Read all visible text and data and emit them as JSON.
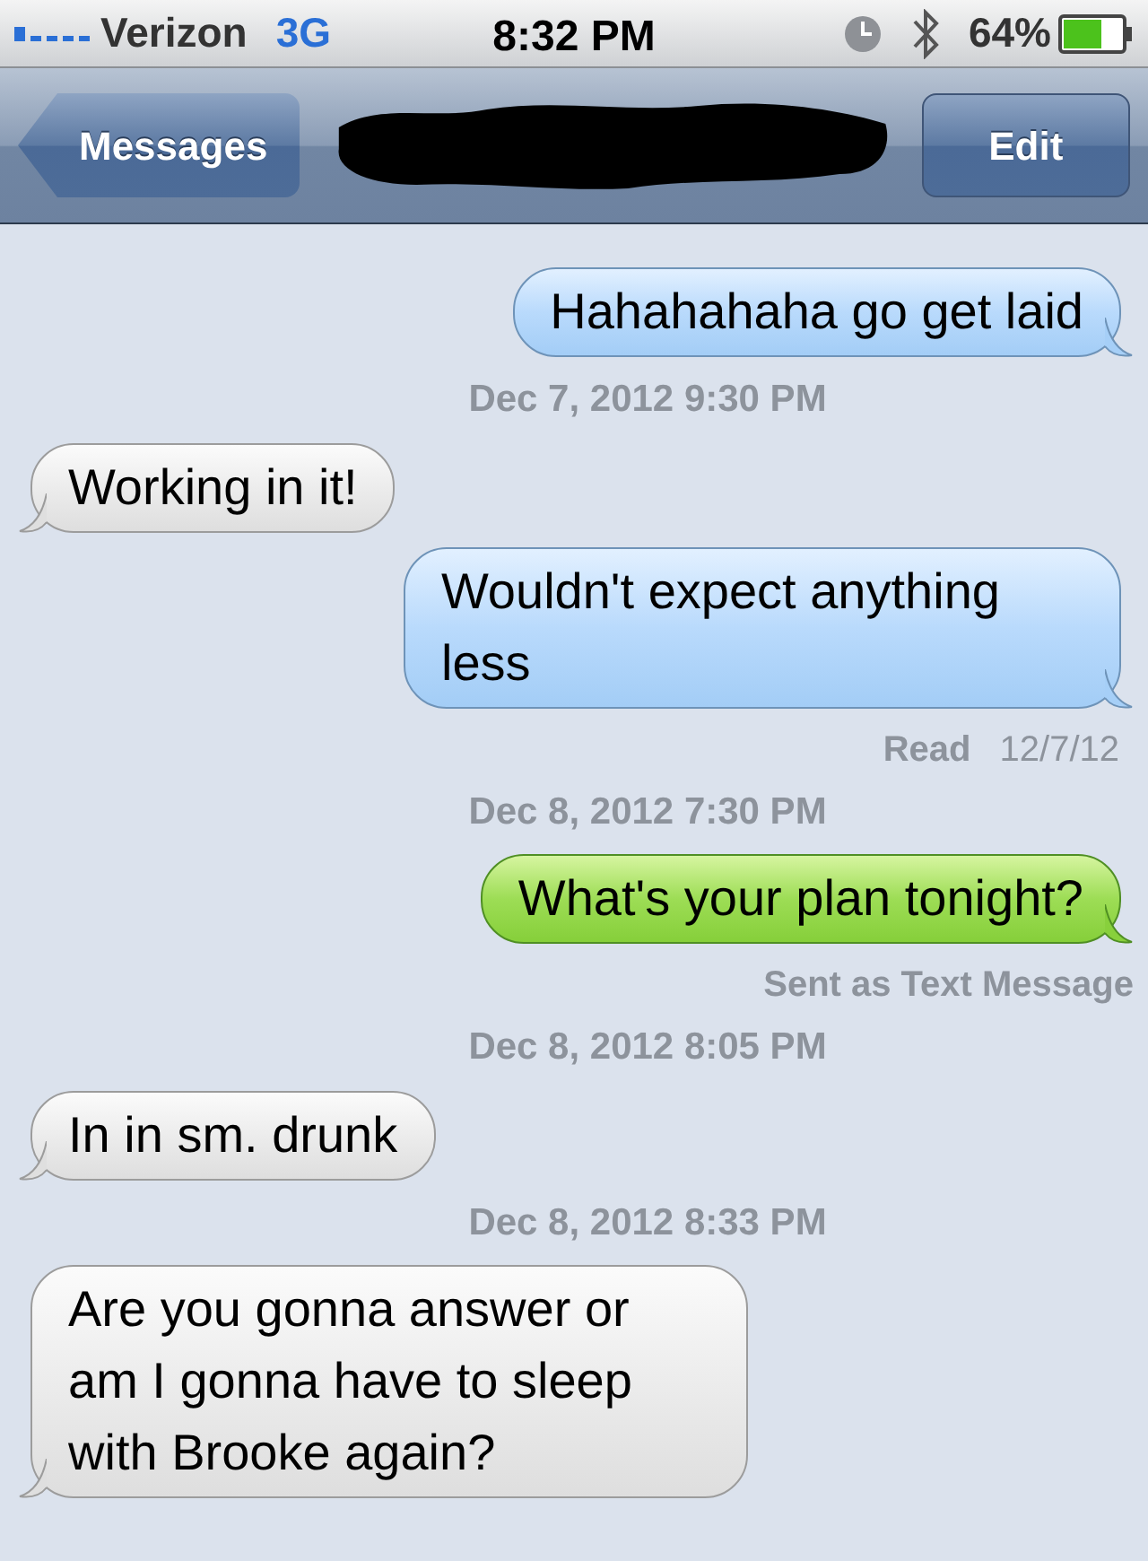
{
  "status_bar": {
    "carrier": "Verizon",
    "network": "3G",
    "time": "8:32 PM",
    "battery": "64%"
  },
  "nav_bar": {
    "back_button": "Messages",
    "edit_button": "Edit"
  },
  "thread": [
    {
      "kind": "message",
      "outgoing": true,
      "text_message": false,
      "text": "Hahahahaha go get laid"
    },
    {
      "kind": "timestamp",
      "text": "Dec 7, 2012 9:30 PM"
    },
    {
      "kind": "message",
      "outgoing": false,
      "text": "Working in it!"
    },
    {
      "kind": "message",
      "outgoing": true,
      "text_message": false,
      "text": "Wouldn't expect anything less"
    },
    {
      "kind": "receipt",
      "label": "Read",
      "date": "12/7/12"
    },
    {
      "kind": "timestamp",
      "text": "Dec 8, 2012 7:30 PM"
    },
    {
      "kind": "message",
      "outgoing": true,
      "text_message": true,
      "text": "What's your plan tonight?"
    },
    {
      "kind": "note",
      "text": "Sent as Text Message"
    },
    {
      "kind": "timestamp",
      "text": "Dec 8, 2012 8:05 PM"
    },
    {
      "kind": "message",
      "outgoing": false,
      "text": "In in sm. drunk"
    },
    {
      "kind": "timestamp",
      "text": "Dec 8, 2012 8:33 PM"
    },
    {
      "kind": "message",
      "outgoing": false,
      "text": "Are you gonna answer or am I gonna have to sleep with Brooke again?"
    }
  ]
}
